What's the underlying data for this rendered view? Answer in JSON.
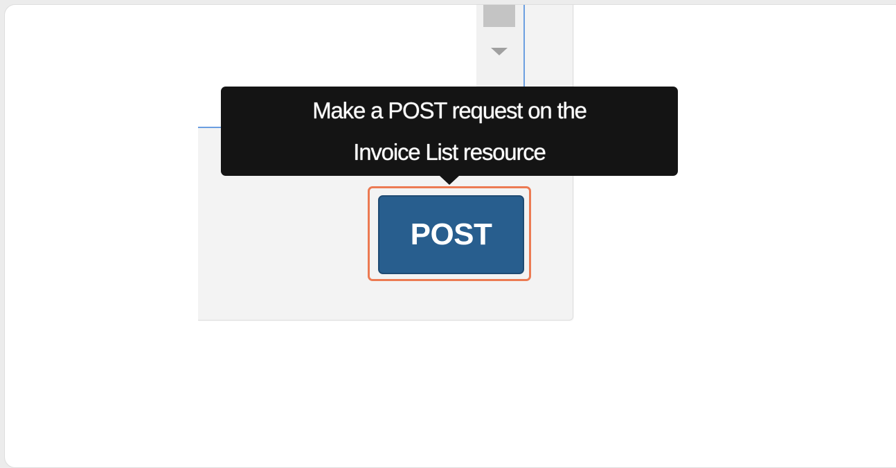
{
  "tooltip": {
    "line1": "Make a POST request on the",
    "line2": "Invoice List resource"
  },
  "button": {
    "label": "POST"
  },
  "colors": {
    "button_bg": "#285e8e",
    "tooltip_bg": "#141414",
    "highlight": "#ec7a52",
    "text_area_border": "#6a9ee0"
  },
  "icons": {
    "scroll_down": "scroll-down-arrow-icon"
  }
}
